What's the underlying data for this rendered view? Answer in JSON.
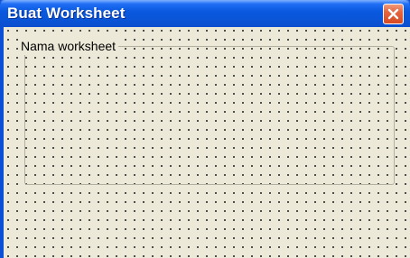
{
  "window": {
    "title": "Buat Worksheet",
    "close_icon": "close-icon",
    "colors": {
      "titlebar": "#0a55d8",
      "close_button": "#e5643e",
      "client_background": "#ece9d8"
    }
  },
  "form": {
    "group_label": "Nama worksheet"
  }
}
